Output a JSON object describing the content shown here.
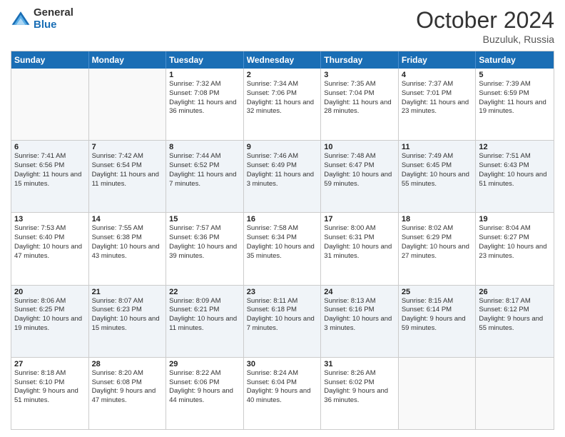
{
  "header": {
    "logo_general": "General",
    "logo_blue": "Blue",
    "month_title": "October 2024",
    "location": "Buzuluk, Russia"
  },
  "days_of_week": [
    "Sunday",
    "Monday",
    "Tuesday",
    "Wednesday",
    "Thursday",
    "Friday",
    "Saturday"
  ],
  "weeks": [
    [
      {
        "day": "",
        "info": ""
      },
      {
        "day": "",
        "info": ""
      },
      {
        "day": "1",
        "info": "Sunrise: 7:32 AM\nSunset: 7:08 PM\nDaylight: 11 hours and 36 minutes."
      },
      {
        "day": "2",
        "info": "Sunrise: 7:34 AM\nSunset: 7:06 PM\nDaylight: 11 hours and 32 minutes."
      },
      {
        "day": "3",
        "info": "Sunrise: 7:35 AM\nSunset: 7:04 PM\nDaylight: 11 hours and 28 minutes."
      },
      {
        "day": "4",
        "info": "Sunrise: 7:37 AM\nSunset: 7:01 PM\nDaylight: 11 hours and 23 minutes."
      },
      {
        "day": "5",
        "info": "Sunrise: 7:39 AM\nSunset: 6:59 PM\nDaylight: 11 hours and 19 minutes."
      }
    ],
    [
      {
        "day": "6",
        "info": "Sunrise: 7:41 AM\nSunset: 6:56 PM\nDaylight: 11 hours and 15 minutes."
      },
      {
        "day": "7",
        "info": "Sunrise: 7:42 AM\nSunset: 6:54 PM\nDaylight: 11 hours and 11 minutes."
      },
      {
        "day": "8",
        "info": "Sunrise: 7:44 AM\nSunset: 6:52 PM\nDaylight: 11 hours and 7 minutes."
      },
      {
        "day": "9",
        "info": "Sunrise: 7:46 AM\nSunset: 6:49 PM\nDaylight: 11 hours and 3 minutes."
      },
      {
        "day": "10",
        "info": "Sunrise: 7:48 AM\nSunset: 6:47 PM\nDaylight: 10 hours and 59 minutes."
      },
      {
        "day": "11",
        "info": "Sunrise: 7:49 AM\nSunset: 6:45 PM\nDaylight: 10 hours and 55 minutes."
      },
      {
        "day": "12",
        "info": "Sunrise: 7:51 AM\nSunset: 6:43 PM\nDaylight: 10 hours and 51 minutes."
      }
    ],
    [
      {
        "day": "13",
        "info": "Sunrise: 7:53 AM\nSunset: 6:40 PM\nDaylight: 10 hours and 47 minutes."
      },
      {
        "day": "14",
        "info": "Sunrise: 7:55 AM\nSunset: 6:38 PM\nDaylight: 10 hours and 43 minutes."
      },
      {
        "day": "15",
        "info": "Sunrise: 7:57 AM\nSunset: 6:36 PM\nDaylight: 10 hours and 39 minutes."
      },
      {
        "day": "16",
        "info": "Sunrise: 7:58 AM\nSunset: 6:34 PM\nDaylight: 10 hours and 35 minutes."
      },
      {
        "day": "17",
        "info": "Sunrise: 8:00 AM\nSunset: 6:31 PM\nDaylight: 10 hours and 31 minutes."
      },
      {
        "day": "18",
        "info": "Sunrise: 8:02 AM\nSunset: 6:29 PM\nDaylight: 10 hours and 27 minutes."
      },
      {
        "day": "19",
        "info": "Sunrise: 8:04 AM\nSunset: 6:27 PM\nDaylight: 10 hours and 23 minutes."
      }
    ],
    [
      {
        "day": "20",
        "info": "Sunrise: 8:06 AM\nSunset: 6:25 PM\nDaylight: 10 hours and 19 minutes."
      },
      {
        "day": "21",
        "info": "Sunrise: 8:07 AM\nSunset: 6:23 PM\nDaylight: 10 hours and 15 minutes."
      },
      {
        "day": "22",
        "info": "Sunrise: 8:09 AM\nSunset: 6:21 PM\nDaylight: 10 hours and 11 minutes."
      },
      {
        "day": "23",
        "info": "Sunrise: 8:11 AM\nSunset: 6:18 PM\nDaylight: 10 hours and 7 minutes."
      },
      {
        "day": "24",
        "info": "Sunrise: 8:13 AM\nSunset: 6:16 PM\nDaylight: 10 hours and 3 minutes."
      },
      {
        "day": "25",
        "info": "Sunrise: 8:15 AM\nSunset: 6:14 PM\nDaylight: 9 hours and 59 minutes."
      },
      {
        "day": "26",
        "info": "Sunrise: 8:17 AM\nSunset: 6:12 PM\nDaylight: 9 hours and 55 minutes."
      }
    ],
    [
      {
        "day": "27",
        "info": "Sunrise: 8:18 AM\nSunset: 6:10 PM\nDaylight: 9 hours and 51 minutes."
      },
      {
        "day": "28",
        "info": "Sunrise: 8:20 AM\nSunset: 6:08 PM\nDaylight: 9 hours and 47 minutes."
      },
      {
        "day": "29",
        "info": "Sunrise: 8:22 AM\nSunset: 6:06 PM\nDaylight: 9 hours and 44 minutes."
      },
      {
        "day": "30",
        "info": "Sunrise: 8:24 AM\nSunset: 6:04 PM\nDaylight: 9 hours and 40 minutes."
      },
      {
        "day": "31",
        "info": "Sunrise: 8:26 AM\nSunset: 6:02 PM\nDaylight: 9 hours and 36 minutes."
      },
      {
        "day": "",
        "info": ""
      },
      {
        "day": "",
        "info": ""
      }
    ]
  ]
}
